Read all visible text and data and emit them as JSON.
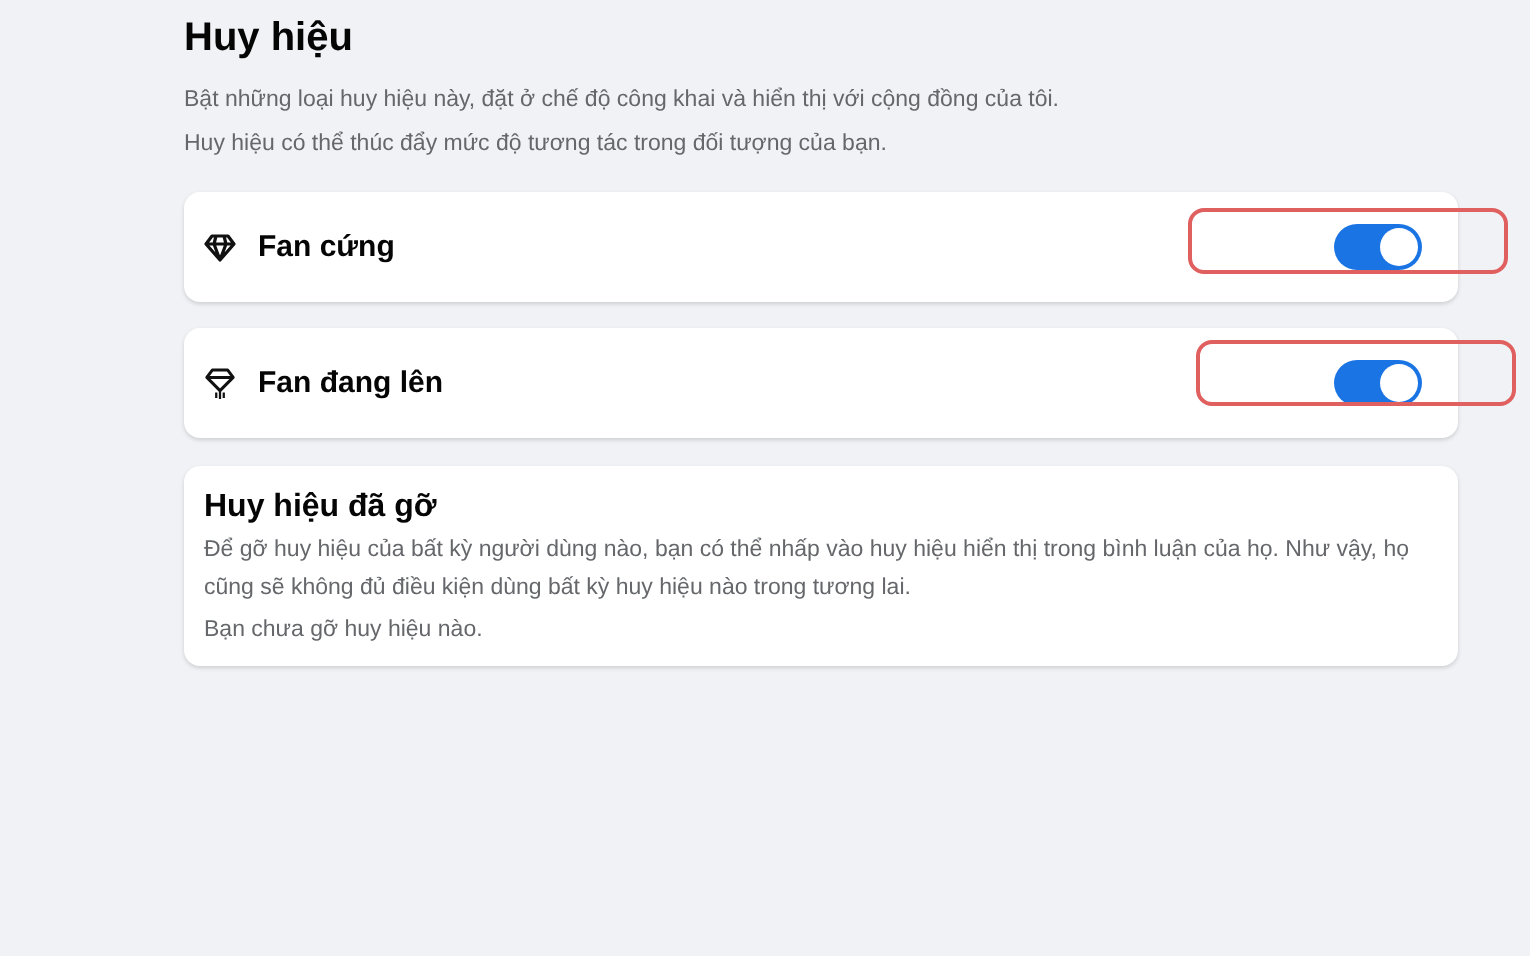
{
  "section": {
    "title": "Huy hiệu",
    "description": [
      "Bật những loại huy hiệu này, đặt ở chế độ công khai và hiển thị với cộng đồng của tôi.",
      "Huy hiệu có thể thúc đẩy mức độ tương tác trong đối tượng của bạn."
    ]
  },
  "badges": [
    {
      "kind": "diamond",
      "label": "Fan cứng",
      "on": true,
      "highlighted": true
    },
    {
      "kind": "rising",
      "label": "Fan đang lên",
      "on": true,
      "highlighted": true
    }
  ],
  "removed": {
    "title": "Huy hiệu đã gỡ",
    "description": "Để gỡ huy hiệu của bất kỳ người dùng nào, bạn có thể nhấp vào huy hiệu hiển thị trong bình luận của họ. Như vậy, họ cũng sẽ không đủ điều kiện dùng bất kỳ huy hiệu nào trong tương lai.",
    "status": "Bạn chưa gỡ huy hiệu nào."
  }
}
